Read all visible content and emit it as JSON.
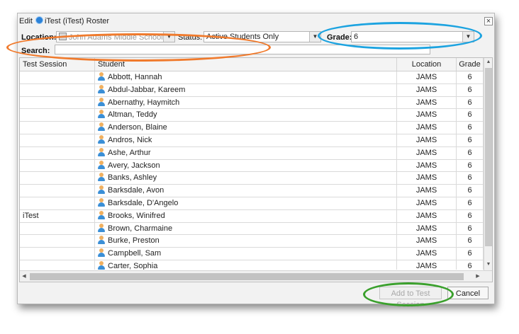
{
  "window": {
    "title_prefix": "Edit",
    "title": "iTest (iTest) Roster",
    "close_label": "×"
  },
  "filters": {
    "location_label": "Location:",
    "location_value": "John Adams Middle School [MA]",
    "status_label": "Status:",
    "status_value": "Active Students Only",
    "grade_label": "Grade:",
    "grade_value": "6",
    "search_label": "Search:",
    "search_value": ""
  },
  "table": {
    "columns": [
      "Test Session",
      "Student",
      "Location",
      "Grade"
    ],
    "rows": [
      {
        "session": "",
        "student": "Abbott, Hannah",
        "location": "JAMS",
        "grade": "6"
      },
      {
        "session": "",
        "student": "Abdul-Jabbar, Kareem",
        "location": "JAMS",
        "grade": "6"
      },
      {
        "session": "",
        "student": "Abernathy, Haymitch",
        "location": "JAMS",
        "grade": "6"
      },
      {
        "session": "",
        "student": "Altman, Teddy",
        "location": "JAMS",
        "grade": "6"
      },
      {
        "session": "",
        "student": "Anderson, Blaine",
        "location": "JAMS",
        "grade": "6"
      },
      {
        "session": "",
        "student": "Andros, Nick",
        "location": "JAMS",
        "grade": "6"
      },
      {
        "session": "",
        "student": "Ashe, Arthur",
        "location": "JAMS",
        "grade": "6"
      },
      {
        "session": "",
        "student": "Avery, Jackson",
        "location": "JAMS",
        "grade": "6"
      },
      {
        "session": "",
        "student": "Banks, Ashley",
        "location": "JAMS",
        "grade": "6"
      },
      {
        "session": "",
        "student": "Barksdale, Avon",
        "location": "JAMS",
        "grade": "6"
      },
      {
        "session": "",
        "student": "Barksdale, D'Angelo",
        "location": "JAMS",
        "grade": "6"
      },
      {
        "session": "iTest",
        "student": "Brooks, Winifred",
        "location": "JAMS",
        "grade": "6"
      },
      {
        "session": "",
        "student": "Brown, Charmaine",
        "location": "JAMS",
        "grade": "6"
      },
      {
        "session": "",
        "student": "Burke, Preston",
        "location": "JAMS",
        "grade": "6"
      },
      {
        "session": "",
        "student": "Campbell, Sam",
        "location": "JAMS",
        "grade": "6"
      },
      {
        "session": "",
        "student": "Carter, Sophia",
        "location": "JAMS",
        "grade": "6"
      }
    ]
  },
  "buttons": {
    "add_label": "Add to Test Session",
    "cancel_label": "Cancel"
  },
  "icons": {
    "title_icon": "itest-icon",
    "student_icon": "person-icon",
    "location_icon": "school-icon",
    "dropdown_icon": "chevron-down-icon"
  },
  "annotation_colors": {
    "search_highlight": "#f07a2c",
    "grade_highlight": "#1ca3e0",
    "add_button_highlight": "#3aa02c"
  }
}
